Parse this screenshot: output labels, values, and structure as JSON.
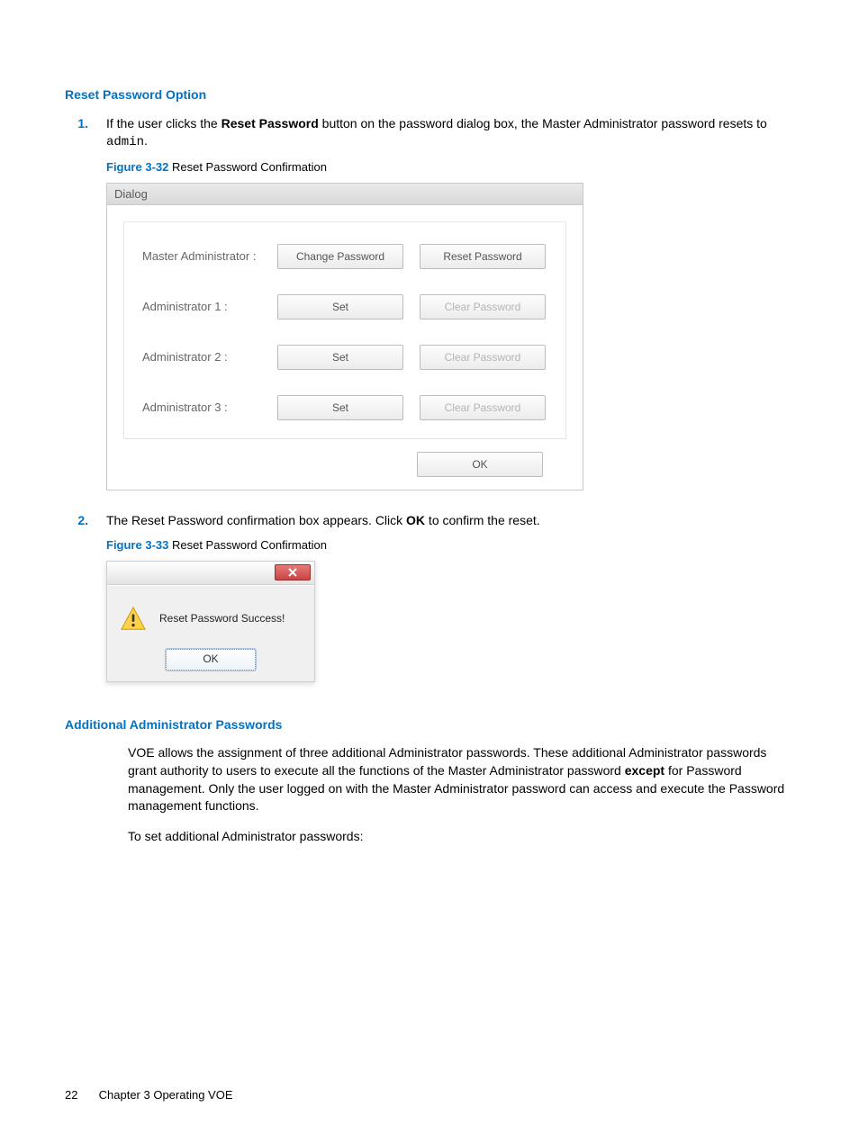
{
  "headings": {
    "reset_password_option": "Reset Password Option",
    "additional_admin_passwords": "Additional Administrator Passwords"
  },
  "step1": {
    "num": "1.",
    "text_pre": "If the user clicks the ",
    "bold": "Reset Password",
    "text_post": " button on the password dialog box, the Master Administrator password resets to ",
    "mono": "admin",
    "period": "."
  },
  "fig32": {
    "label": "Figure 3-32",
    "caption": "  Reset Password Confirmation"
  },
  "dialog1": {
    "title": "Dialog",
    "rows": [
      {
        "label": "Master Administrator :",
        "btn1": "Change Password",
        "btn2": "Reset Password",
        "btn2_disabled": false
      },
      {
        "label": "Administrator 1 :",
        "btn1": "Set",
        "btn2": "Clear Password",
        "btn2_disabled": true
      },
      {
        "label": "Administrator 2 :",
        "btn1": "Set",
        "btn2": "Clear Password",
        "btn2_disabled": true
      },
      {
        "label": "Administrator 3 :",
        "btn1": "Set",
        "btn2": "Clear Password",
        "btn2_disabled": true
      }
    ],
    "ok": "OK"
  },
  "step2": {
    "num": "2.",
    "text_pre": "The Reset Password confirmation box appears. Click ",
    "bold": "OK",
    "text_post": " to confirm the reset."
  },
  "fig33": {
    "label": "Figure 3-33",
    "caption": "  Reset Password Confirmation"
  },
  "dialog2": {
    "message": "Reset Password Success!",
    "ok": "OK"
  },
  "additional": {
    "para_pre": "VOE allows the assignment of three additional Administrator passwords. These additional Administrator passwords grant authority to users to execute all the functions of the Master Administrator password ",
    "bold": "except",
    "para_post": " for Password management. Only the user logged on with the Master Administrator password can access and execute the Password management functions.",
    "para2": "To set additional Administrator passwords:"
  },
  "footer": {
    "page": "22",
    "chapter": "Chapter 3   Operating VOE"
  }
}
